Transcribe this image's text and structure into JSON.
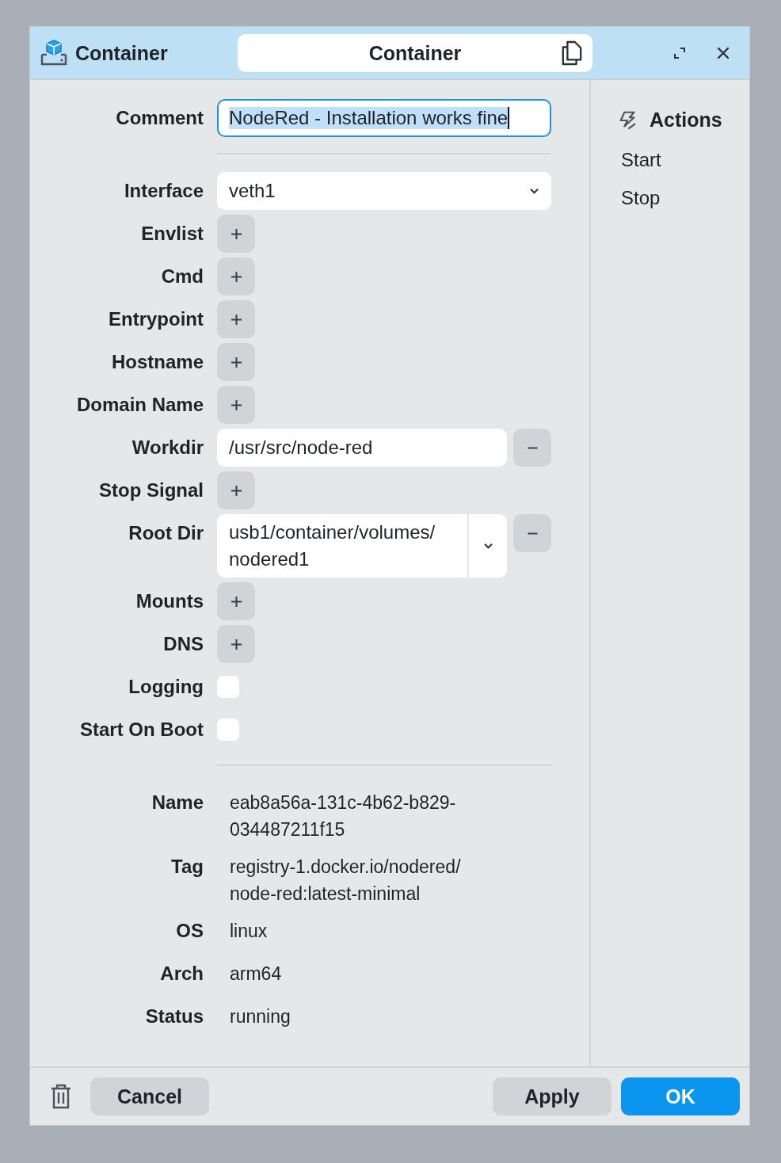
{
  "window": {
    "title": "Container",
    "center_title": "Container"
  },
  "sections": [
    [
      {
        "kind": "text",
        "label": "Comment",
        "value": "NodeRed - Installation works fine"
      }
    ],
    [
      {
        "kind": "select",
        "label": "Interface",
        "value": "veth1"
      },
      {
        "kind": "add",
        "label": "Envlist"
      },
      {
        "kind": "add",
        "label": "Cmd"
      },
      {
        "kind": "add",
        "label": "Entrypoint"
      },
      {
        "kind": "add",
        "label": "Hostname"
      },
      {
        "kind": "add",
        "label": "Domain Name"
      },
      {
        "kind": "value",
        "label": "Workdir",
        "value": "/usr/src/node-red"
      },
      {
        "kind": "add",
        "label": "Stop Signal"
      },
      {
        "kind": "path",
        "label": "Root Dir",
        "value": "usb1/container/volumes/nodered1"
      },
      {
        "kind": "add",
        "label": "Mounts"
      },
      {
        "kind": "add",
        "label": "DNS"
      },
      {
        "kind": "checkbox",
        "label": "Logging",
        "checked": false
      },
      {
        "kind": "checkbox",
        "label": "Start On Boot",
        "checked": false
      }
    ],
    [
      {
        "kind": "info",
        "label": "Name",
        "value": "eab8a56a-131c-4b62-b829-034487211f15"
      },
      {
        "kind": "info",
        "label": "Tag",
        "value": "registry-1.docker.io/nodered/node-red:latest-minimal"
      },
      {
        "kind": "info",
        "label": "OS",
        "value": "linux"
      },
      {
        "kind": "info",
        "label": "Arch",
        "value": "arm64"
      },
      {
        "kind": "info",
        "label": "Status",
        "value": "running"
      }
    ]
  ],
  "actions": {
    "title": "Actions",
    "items": [
      "Start",
      "Stop"
    ]
  },
  "footer": {
    "left": [
      {
        "kind": "secondary",
        "label": "Cancel"
      }
    ],
    "right": [
      {
        "kind": "secondary",
        "label": "Apply"
      },
      {
        "kind": "primary",
        "label": "OK"
      }
    ]
  }
}
